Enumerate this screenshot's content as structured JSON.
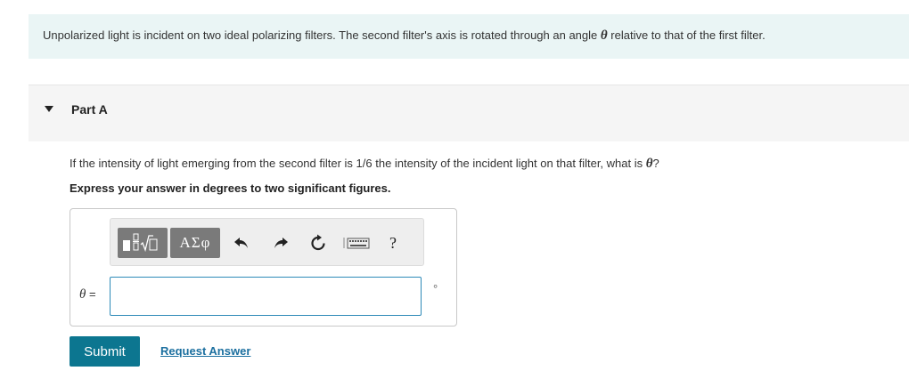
{
  "intro": {
    "text_before": "Unpolarized light is incident on two ideal polarizing filters. The second filter's axis is rotated through an angle ",
    "symbol": "θ",
    "text_after": " relative to that of the first filter."
  },
  "part": {
    "title": "Part A"
  },
  "question": {
    "text_before": "If the intensity of light emerging from the second filter is 1/6 the intensity of the incident light on that filter, what is ",
    "symbol": "θ",
    "text_after": "?"
  },
  "instruction": "Express your answer in degrees to two significant figures.",
  "toolbar": {
    "greek_label": "ΑΣφ",
    "help_label": "?"
  },
  "answer": {
    "variable": "θ",
    "equals": " =",
    "value": "",
    "unit": "°"
  },
  "actions": {
    "submit_label": "Submit",
    "request_label": "Request Answer"
  }
}
